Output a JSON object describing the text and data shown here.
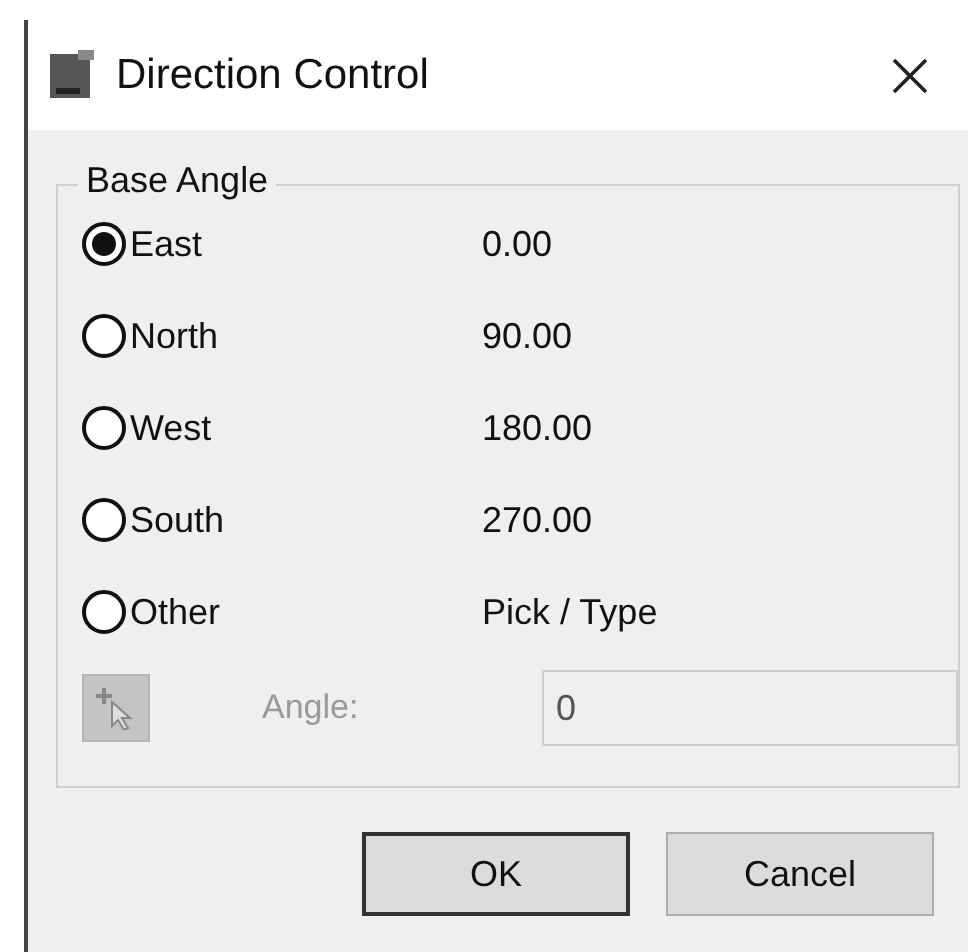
{
  "window": {
    "title": "Direction Control"
  },
  "group": {
    "title": "Base Angle",
    "options": [
      {
        "label": "East",
        "value": "0.00",
        "selected": true
      },
      {
        "label": "North",
        "value": "90.00",
        "selected": false
      },
      {
        "label": "West",
        "value": "180.00",
        "selected": false
      },
      {
        "label": "South",
        "value": "270.00",
        "selected": false
      },
      {
        "label": "Other",
        "value": "Pick / Type",
        "selected": false
      }
    ],
    "angle": {
      "label": "Angle:",
      "value": "0",
      "disabled": true
    }
  },
  "buttons": [
    {
      "label": "OK",
      "default": true
    },
    {
      "label": "Cancel",
      "default": false
    }
  ]
}
